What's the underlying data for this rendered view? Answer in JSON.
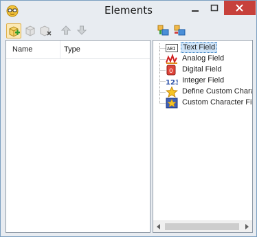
{
  "window": {
    "title": "Elements",
    "controls": {
      "minimize": "minimize",
      "maximize": "maximize",
      "close": "close"
    }
  },
  "toolbar_left": [
    {
      "icon": "new-element-icon",
      "enabled": true,
      "active": true
    },
    {
      "icon": "edit-element-icon",
      "enabled": false
    },
    {
      "icon": "delete-element-icon",
      "enabled": false
    },
    {
      "icon": "move-up-icon",
      "enabled": false
    },
    {
      "icon": "move-down-icon",
      "enabled": false
    }
  ],
  "toolbar_right": [
    {
      "icon": "expand-tree-icon",
      "enabled": true
    },
    {
      "icon": "collapse-tree-icon",
      "enabled": true
    }
  ],
  "element_list": {
    "columns": [
      "Name",
      "Type"
    ],
    "rows": []
  },
  "tree": {
    "items": [
      {
        "label": "Text Field",
        "icon": "text-field-icon",
        "selected": true
      },
      {
        "label": "Analog Field",
        "icon": "analog-field-icon",
        "selected": false
      },
      {
        "label": "Digital Field",
        "icon": "digital-field-icon",
        "selected": false
      },
      {
        "label": "Integer Field",
        "icon": "integer-field-icon",
        "selected": false
      },
      {
        "label": "Define Custom Chara",
        "icon": "star-icon",
        "selected": false
      },
      {
        "label": "Custom Character Fi",
        "icon": "custom-character-icon",
        "selected": false
      }
    ]
  },
  "colors": {
    "close_button": "#c7413b",
    "selection": "#cfe4f8",
    "window_bg": "#e8ecf1"
  }
}
